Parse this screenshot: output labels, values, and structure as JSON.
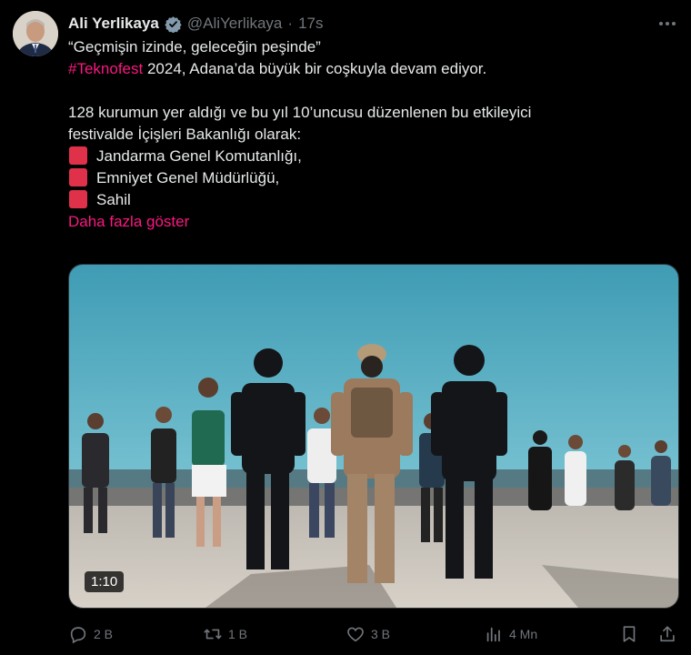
{
  "author": {
    "name": "Ali Yerlikaya",
    "handle": "@AliYerlikaya",
    "separator": "·",
    "time": "17s"
  },
  "tweet": {
    "line1": "“Geçmişin izinde, geleceğin peşinde”",
    "hashtag": "#Teknofest",
    "line2_rest": " 2024, Adana’da büyük bir coşkuyla devam ediyor.",
    "line3": "128 kurumun yer aldığı ve bu yıl 10’uncusu düzenlenen bu etkileyici",
    "line4": "festivalde İçişleri Bakanlığı olarak:",
    "list": [
      "Jandarma Genel Komutanlığı,",
      "Emniyet Genel Müdürlüğü,",
      "Sahil"
    ],
    "show_more": "Daha fazla göster"
  },
  "media": {
    "duration": "1:10"
  },
  "actions": {
    "replies": "2 B",
    "reposts": "1 B",
    "likes": "3 B",
    "views": "4 Mn"
  },
  "colors": {
    "background": "#000000",
    "text": "#e7e9ea",
    "muted": "#71767b",
    "accent": "#f91880",
    "verified": "#829aab"
  },
  "icons": [
    "more-icon",
    "verified-badge-icon",
    "reply-icon",
    "repost-icon",
    "like-icon",
    "views-icon",
    "bookmark-icon",
    "share-icon"
  ]
}
